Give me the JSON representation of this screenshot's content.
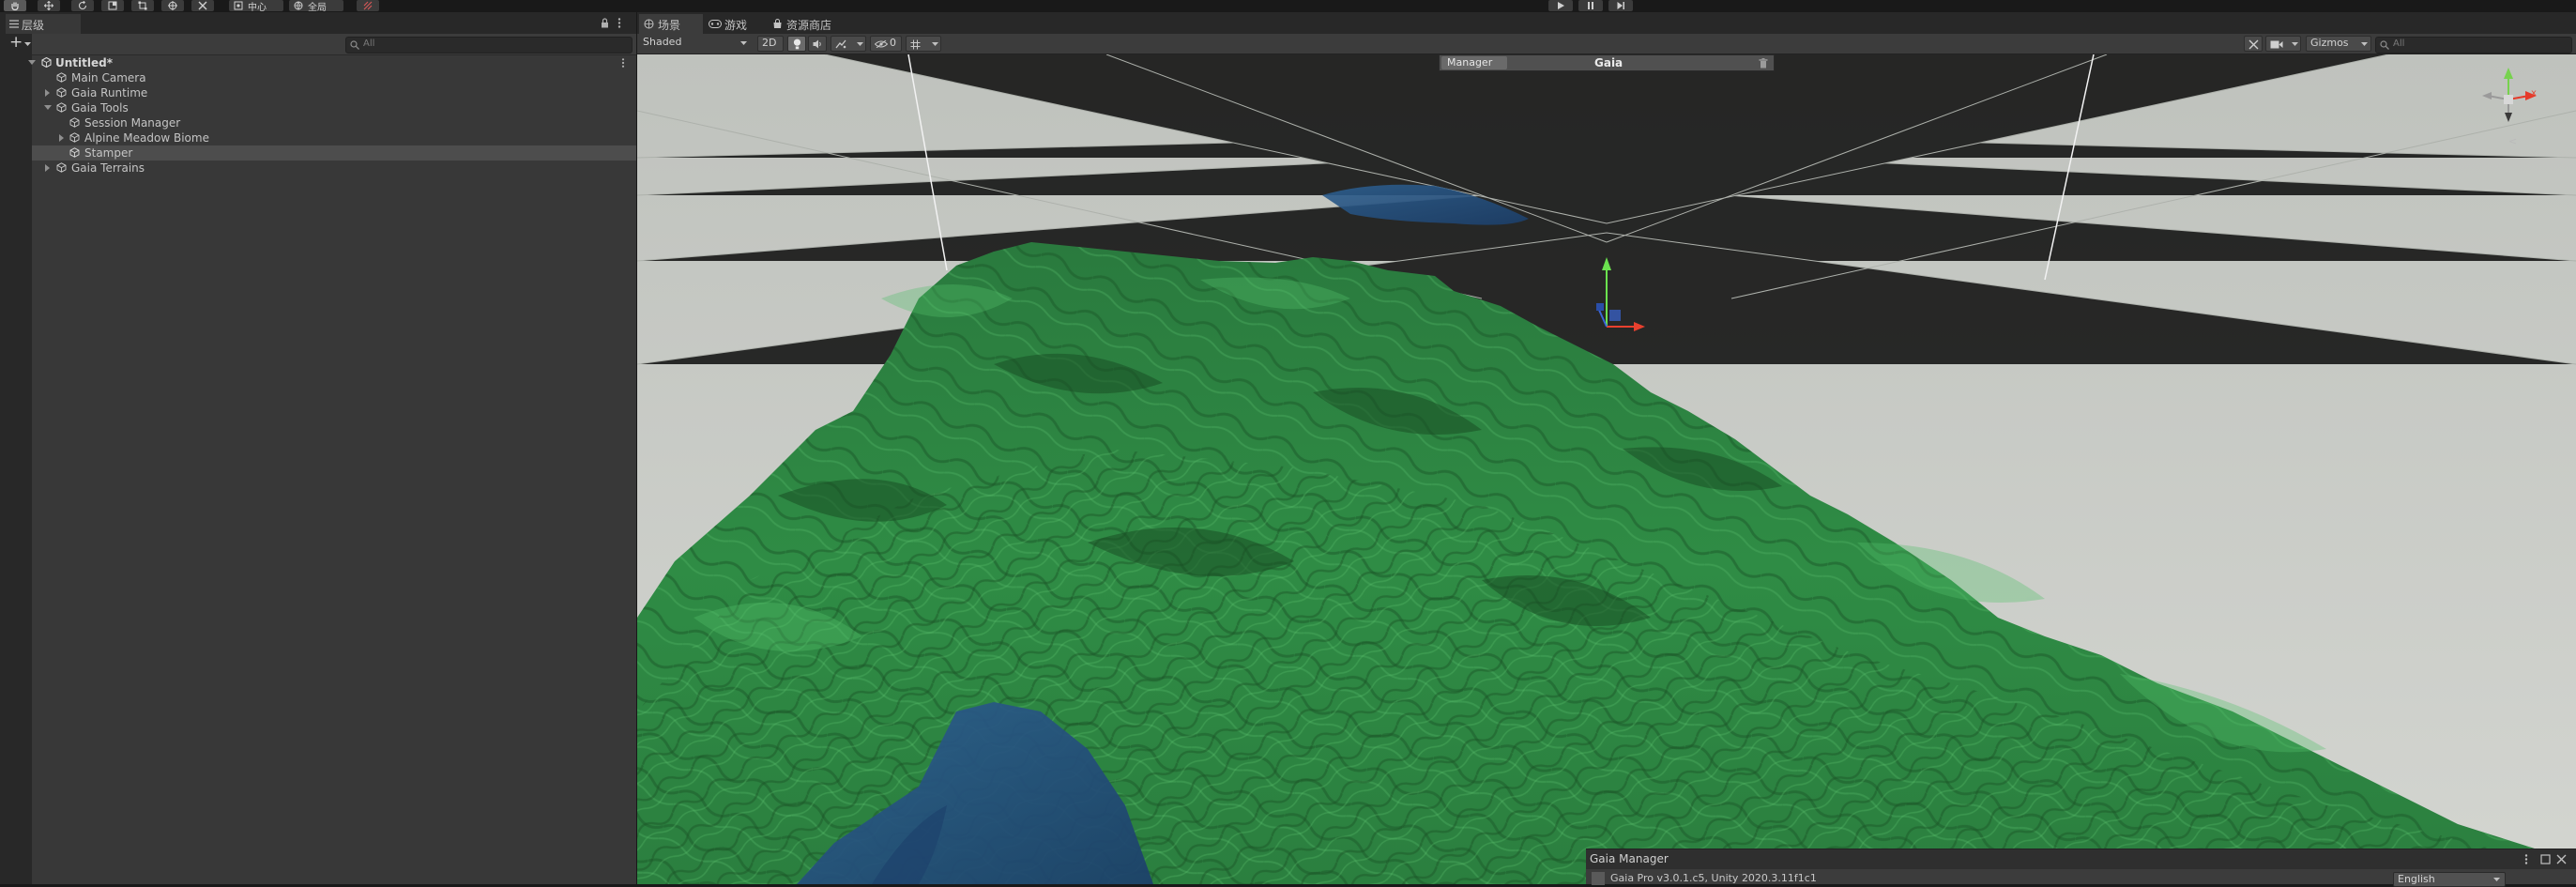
{
  "toolbar": {
    "pivot_label": "中心",
    "space_label": "全局",
    "play_icon": "play-icon",
    "pause_icon": "pause-icon",
    "step_icon": "step-icon"
  },
  "hierarchy": {
    "tab_label": "层级",
    "add_label": "+",
    "search_placeholder": "All",
    "scene_name": "Untitled*",
    "items": [
      {
        "label": "Main Camera"
      },
      {
        "label": "Gaia Runtime"
      },
      {
        "label": "Gaia Tools"
      },
      {
        "label": "Session Manager"
      },
      {
        "label": "Alpine Meadow Biome"
      },
      {
        "label": "Stamper"
      },
      {
        "label": "Gaia Terrains"
      }
    ]
  },
  "scene": {
    "tabs": [
      {
        "label": "场景",
        "icon": "scene-icon"
      },
      {
        "label": "游戏",
        "icon": "game-icon"
      },
      {
        "label": "资源商店",
        "icon": "store-icon"
      }
    ],
    "shading_mode": "Shaded",
    "mode_2d": "2D",
    "hidden_count": "0",
    "gizmos_label": "Gizmos",
    "search_placeholder": "All",
    "manager_label": "Manager",
    "gaia_label": "Gaia",
    "axis_x": "x",
    "axis_back": "<",
    "colors": {
      "sky": "#c8cbc6",
      "terrain": "#2e8a46",
      "water": "#234a7a"
    }
  },
  "gaia_manager": {
    "title": "Gaia Manager",
    "version_text": "Gaia Pro v3.0.1.c5, Unity 2020.3.11f1c1",
    "language": "English"
  }
}
